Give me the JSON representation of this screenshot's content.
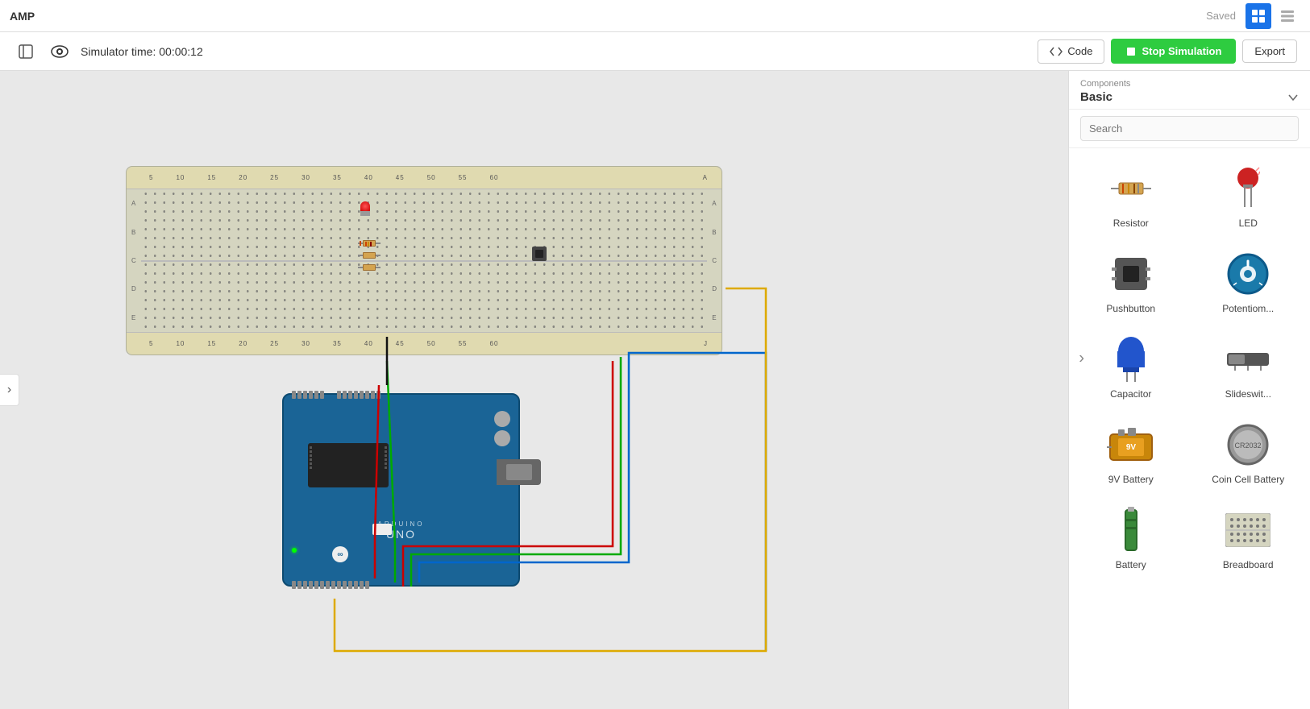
{
  "app": {
    "title": "AMP",
    "saved_label": "Saved"
  },
  "toolbar": {
    "sim_time_label": "Simulator time: 00:00:12",
    "code_label": "Code",
    "stop_sim_label": "Stop Simulation",
    "export_label": "Export"
  },
  "sidebar": {
    "components_section": "Components",
    "dropdown_label": "Basic",
    "search_placeholder": "Search",
    "components": [
      {
        "id": "resistor",
        "label": "Resistor"
      },
      {
        "id": "led",
        "label": "LED"
      },
      {
        "id": "pushbutton",
        "label": "Pushbutton"
      },
      {
        "id": "potentiometer",
        "label": "Potentiom..."
      },
      {
        "id": "capacitor",
        "label": "Capacitor"
      },
      {
        "id": "slideswitch",
        "label": "Slideswit..."
      },
      {
        "id": "9v-battery",
        "label": "9V Battery"
      },
      {
        "id": "coin-cell",
        "label": "Coin Cell Battery"
      },
      {
        "id": "battery",
        "label": "Battery"
      },
      {
        "id": "breadboard",
        "label": "Breadboard"
      }
    ]
  },
  "canvas": {
    "breadboard_label": "Breadboard",
    "arduino_label": "ARDUINO",
    "arduino_model": "UNO"
  },
  "colors": {
    "accent_blue": "#1a73e8",
    "stop_green": "#2ecc40",
    "arduino_blue": "#1a6496",
    "wire_red": "#cc0000",
    "wire_green": "#00aa00",
    "wire_blue": "#0066cc",
    "wire_yellow": "#ddaa00",
    "wire_black": "#111111"
  }
}
